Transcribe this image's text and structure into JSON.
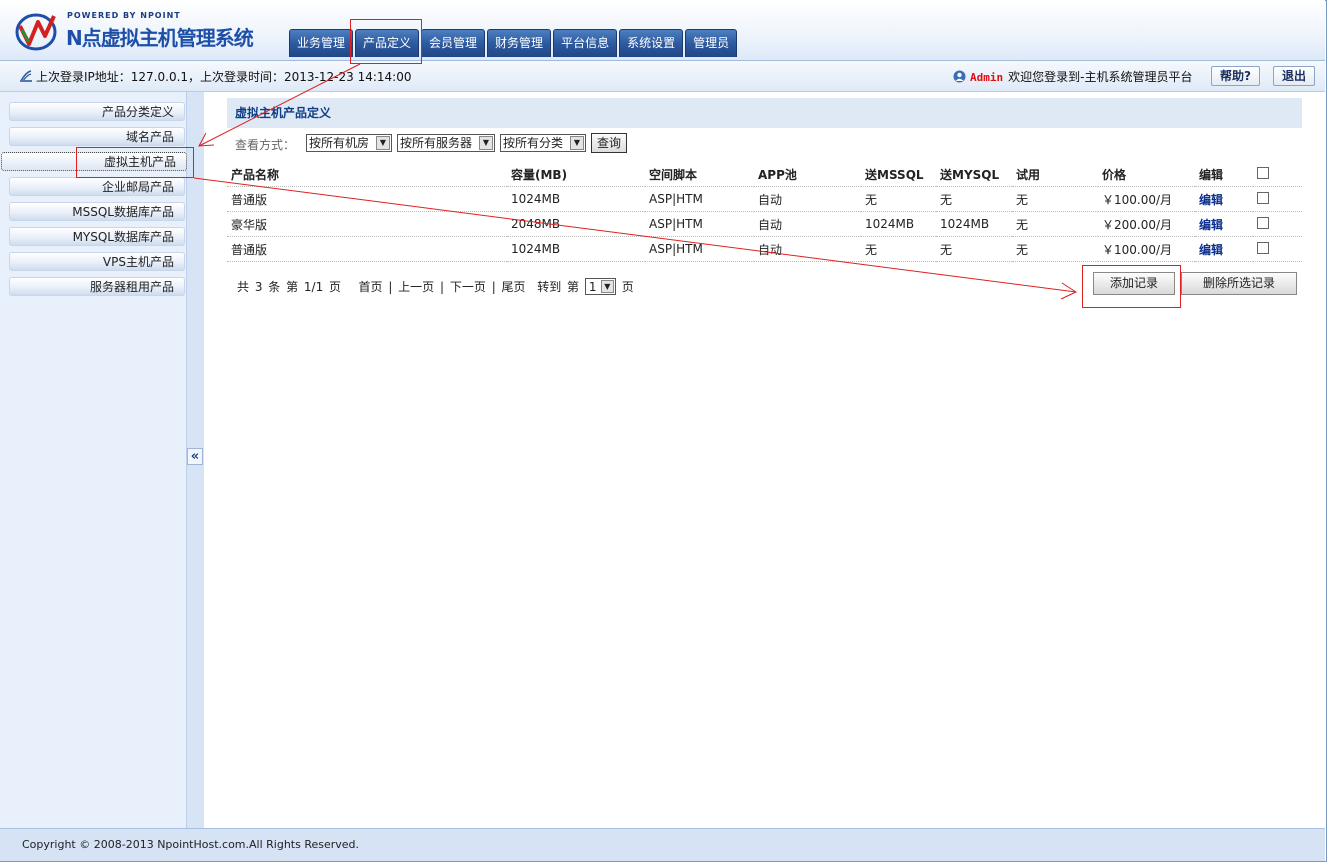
{
  "header": {
    "powered": "POWERED BY NPOINT",
    "brand": "N点虚拟主机管理系统",
    "nav": [
      "业务管理",
      "产品定义",
      "会员管理",
      "财务管理",
      "平台信息",
      "系统设置",
      "管理员"
    ]
  },
  "infobar": {
    "last_login": "上次登录IP地址：127.0.0.1，上次登录时间：2013-12-23 14:14:00",
    "admin": "Admin",
    "welcome": "欢迎您登录到-主机系统管理员平台",
    "help": "帮助?",
    "logout": "退出"
  },
  "sidebar": {
    "items": [
      "产品分类定义",
      "域名产品",
      "虚拟主机产品",
      "企业邮局产品",
      "MSSQL数据库产品",
      "MYSQL数据库产品",
      "VPS主机产品",
      "服务器租用产品"
    ],
    "active": "虚拟主机产品",
    "collapse": "«"
  },
  "main": {
    "title": "虚拟主机产品定义",
    "filter": {
      "label": "查看方式：",
      "room": "按所有机房",
      "server": "按所有服务器",
      "category": "按所有分类",
      "query": "查询"
    },
    "columns": [
      "产品名称",
      "容量(MB)",
      "空间脚本",
      "APP池",
      "送MSSQL",
      "送MYSQL",
      "试用",
      "价格",
      "编辑"
    ],
    "rows": [
      [
        "普通版",
        "1024MB",
        "ASP|HTM",
        "自动",
        "无",
        "无",
        "无",
        "￥100.00/月",
        "编辑"
      ],
      [
        "豪华版",
        "2048MB",
        "ASP|HTM",
        "自动",
        "1024MB",
        "1024MB",
        "无",
        "￥200.00/月",
        "编辑"
      ],
      [
        "普通版",
        "1024MB",
        "ASP|HTM",
        "自动",
        "无",
        "无",
        "无",
        "￥100.00/月",
        "编辑"
      ]
    ],
    "pager": {
      "summary": "共 3 条 第 1/1 页",
      "first": "首页",
      "prev": "上一页",
      "next": "下一页",
      "last": "尾页",
      "goto": "转到 第",
      "page_value": "1",
      "page_unit": "页"
    },
    "add": "添加记录",
    "delete": "删除所选记录"
  },
  "footer": {
    "copyright": "Copyright © 2008-2013 NpointHost.com.All Rights Reserved."
  },
  "colors": {
    "accent": "#2d5aa0",
    "annotation": "#e02020",
    "title": "#0e3f86"
  }
}
